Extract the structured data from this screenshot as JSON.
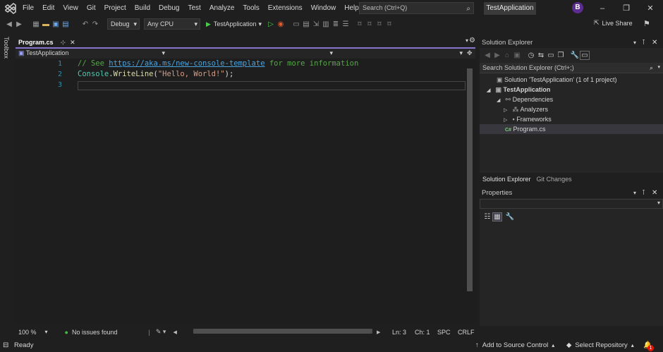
{
  "menu": [
    "File",
    "Edit",
    "View",
    "Git",
    "Project",
    "Build",
    "Debug",
    "Test",
    "Analyze",
    "Tools",
    "Extensions",
    "Window",
    "Help"
  ],
  "search": {
    "placeholder": "Search (Ctrl+Q)"
  },
  "app_title": "TestApplication",
  "avatar_initial": "B",
  "toolbar": {
    "config": "Debug",
    "platform": "Any CPU",
    "run_target": "TestApplication",
    "live_share": "Live Share"
  },
  "toolbox_label": "Toolbox",
  "editor": {
    "tab_label": "Program.cs",
    "nav_scope": "TestApplication",
    "line_numbers": [
      "1",
      "2",
      "3"
    ],
    "code": {
      "l1_comment_prefix": "// See ",
      "l1_link": "https://aka.ms/new-console-template",
      "l1_comment_suffix": " for more information",
      "l2_class": "Console",
      "l2_dot": ".",
      "l2_method": "WriteLine",
      "l2_open": "(",
      "l2_string": "\"Hello, World!\"",
      "l2_close": ");"
    },
    "status": {
      "zoom": "100 %",
      "issues": "No issues found",
      "line": "Ln: 3",
      "col": "Ch: 1",
      "whitespace": "SPC",
      "line_endings": "CRLF"
    }
  },
  "solution_explorer": {
    "title": "Solution Explorer",
    "search_placeholder": "Search Solution Explorer (Ctrl+;)",
    "tree": [
      "Solution 'TestApplication' (1 of 1 project)",
      "TestApplication",
      "Dependencies",
      "Analyzers",
      "Frameworks",
      "Program.cs"
    ],
    "tabs": [
      "Solution Explorer",
      "Git Changes"
    ]
  },
  "properties": {
    "title": "Properties"
  },
  "statusbar": {
    "ready": "Ready",
    "add_source": "Add to Source Control",
    "select_repo": "Select Repository",
    "notifications": "1"
  },
  "colors": {
    "accent": "#8a72d0",
    "run_green": "#4ec94e",
    "line_number": "#2b91af",
    "comment": "#57a64a",
    "link": "#4aa3df",
    "type": "#4ec9b0",
    "method": "#dcdcaa",
    "string": "#d69d85"
  }
}
